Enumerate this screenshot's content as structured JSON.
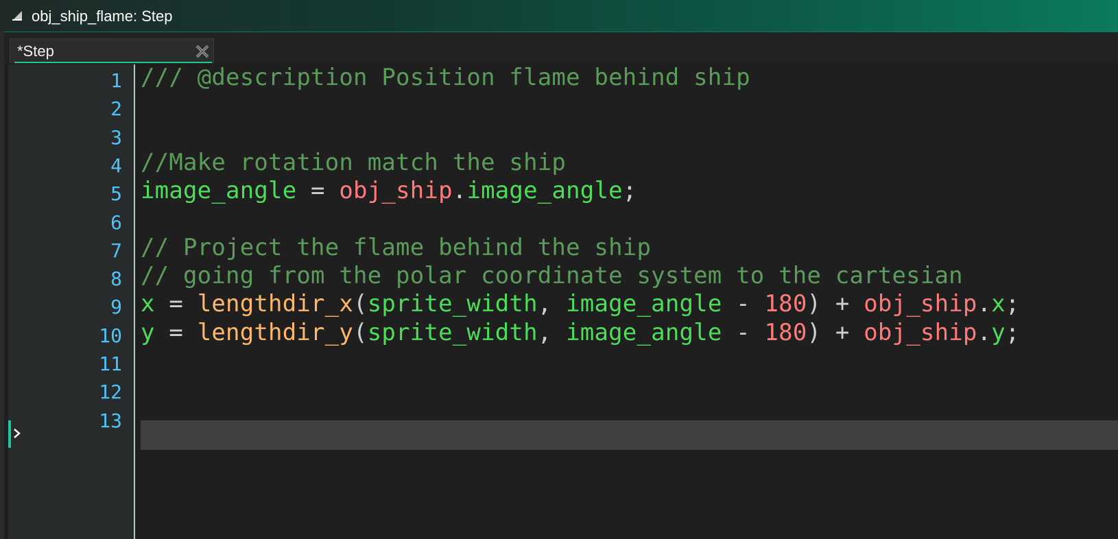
{
  "window": {
    "title": "obj_ship_flame: Step"
  },
  "tabs": [
    {
      "label": "*Step",
      "close_icon": "close-icon"
    }
  ],
  "editor": {
    "current_line": 13,
    "colors": {
      "comment": "#5b9c5b",
      "variable": "#4ddd5a",
      "function": "#ffb86b",
      "object": "#ff7b7b",
      "number": "#ff7b7b",
      "line_number": "#4fc3f7",
      "accent": "#21c79b"
    },
    "lines": [
      {
        "number": "1",
        "tokens": [
          {
            "t": "/// @description Position flame behind ship",
            "k": "comment"
          }
        ]
      },
      {
        "number": "2",
        "tokens": []
      },
      {
        "number": "3",
        "tokens": []
      },
      {
        "number": "4",
        "tokens": [
          {
            "t": "//Make rotation match the ship",
            "k": "comment"
          }
        ]
      },
      {
        "number": "5",
        "tokens": [
          {
            "t": "image_angle",
            "k": "var"
          },
          {
            "t": " = ",
            "k": "punct"
          },
          {
            "t": "obj_ship",
            "k": "obj"
          },
          {
            "t": ".",
            "k": "punct"
          },
          {
            "t": "image_angle",
            "k": "var"
          },
          {
            "t": ";",
            "k": "punct"
          }
        ]
      },
      {
        "number": "6",
        "tokens": []
      },
      {
        "number": "7",
        "tokens": [
          {
            "t": "// Project the flame behind the ship",
            "k": "comment"
          }
        ]
      },
      {
        "number": "8",
        "tokens": [
          {
            "t": "// going from the polar coordinate system to the cartesian",
            "k": "comment"
          }
        ]
      },
      {
        "number": "9",
        "tokens": [
          {
            "t": "x",
            "k": "var"
          },
          {
            "t": " = ",
            "k": "punct"
          },
          {
            "t": "lengthdir_x",
            "k": "func"
          },
          {
            "t": "(",
            "k": "punct"
          },
          {
            "t": "sprite_width",
            "k": "var"
          },
          {
            "t": ", ",
            "k": "punct"
          },
          {
            "t": "image_angle",
            "k": "var"
          },
          {
            "t": " - ",
            "k": "punct"
          },
          {
            "t": "180",
            "k": "num"
          },
          {
            "t": ") + ",
            "k": "punct"
          },
          {
            "t": "obj_ship",
            "k": "obj"
          },
          {
            "t": ".",
            "k": "punct"
          },
          {
            "t": "x",
            "k": "var"
          },
          {
            "t": ";",
            "k": "punct"
          }
        ]
      },
      {
        "number": "10",
        "tokens": [
          {
            "t": "y",
            "k": "var"
          },
          {
            "t": " = ",
            "k": "punct"
          },
          {
            "t": "lengthdir_y",
            "k": "func"
          },
          {
            "t": "(",
            "k": "punct"
          },
          {
            "t": "sprite_width",
            "k": "var"
          },
          {
            "t": ", ",
            "k": "punct"
          },
          {
            "t": "image_angle",
            "k": "var"
          },
          {
            "t": " - ",
            "k": "punct"
          },
          {
            "t": "180",
            "k": "num"
          },
          {
            "t": ") + ",
            "k": "punct"
          },
          {
            "t": "obj_ship",
            "k": "obj"
          },
          {
            "t": ".",
            "k": "punct"
          },
          {
            "t": "y",
            "k": "var"
          },
          {
            "t": ";",
            "k": "punct"
          }
        ]
      },
      {
        "number": "11",
        "tokens": []
      },
      {
        "number": "12",
        "tokens": []
      },
      {
        "number": "13",
        "tokens": []
      }
    ]
  }
}
